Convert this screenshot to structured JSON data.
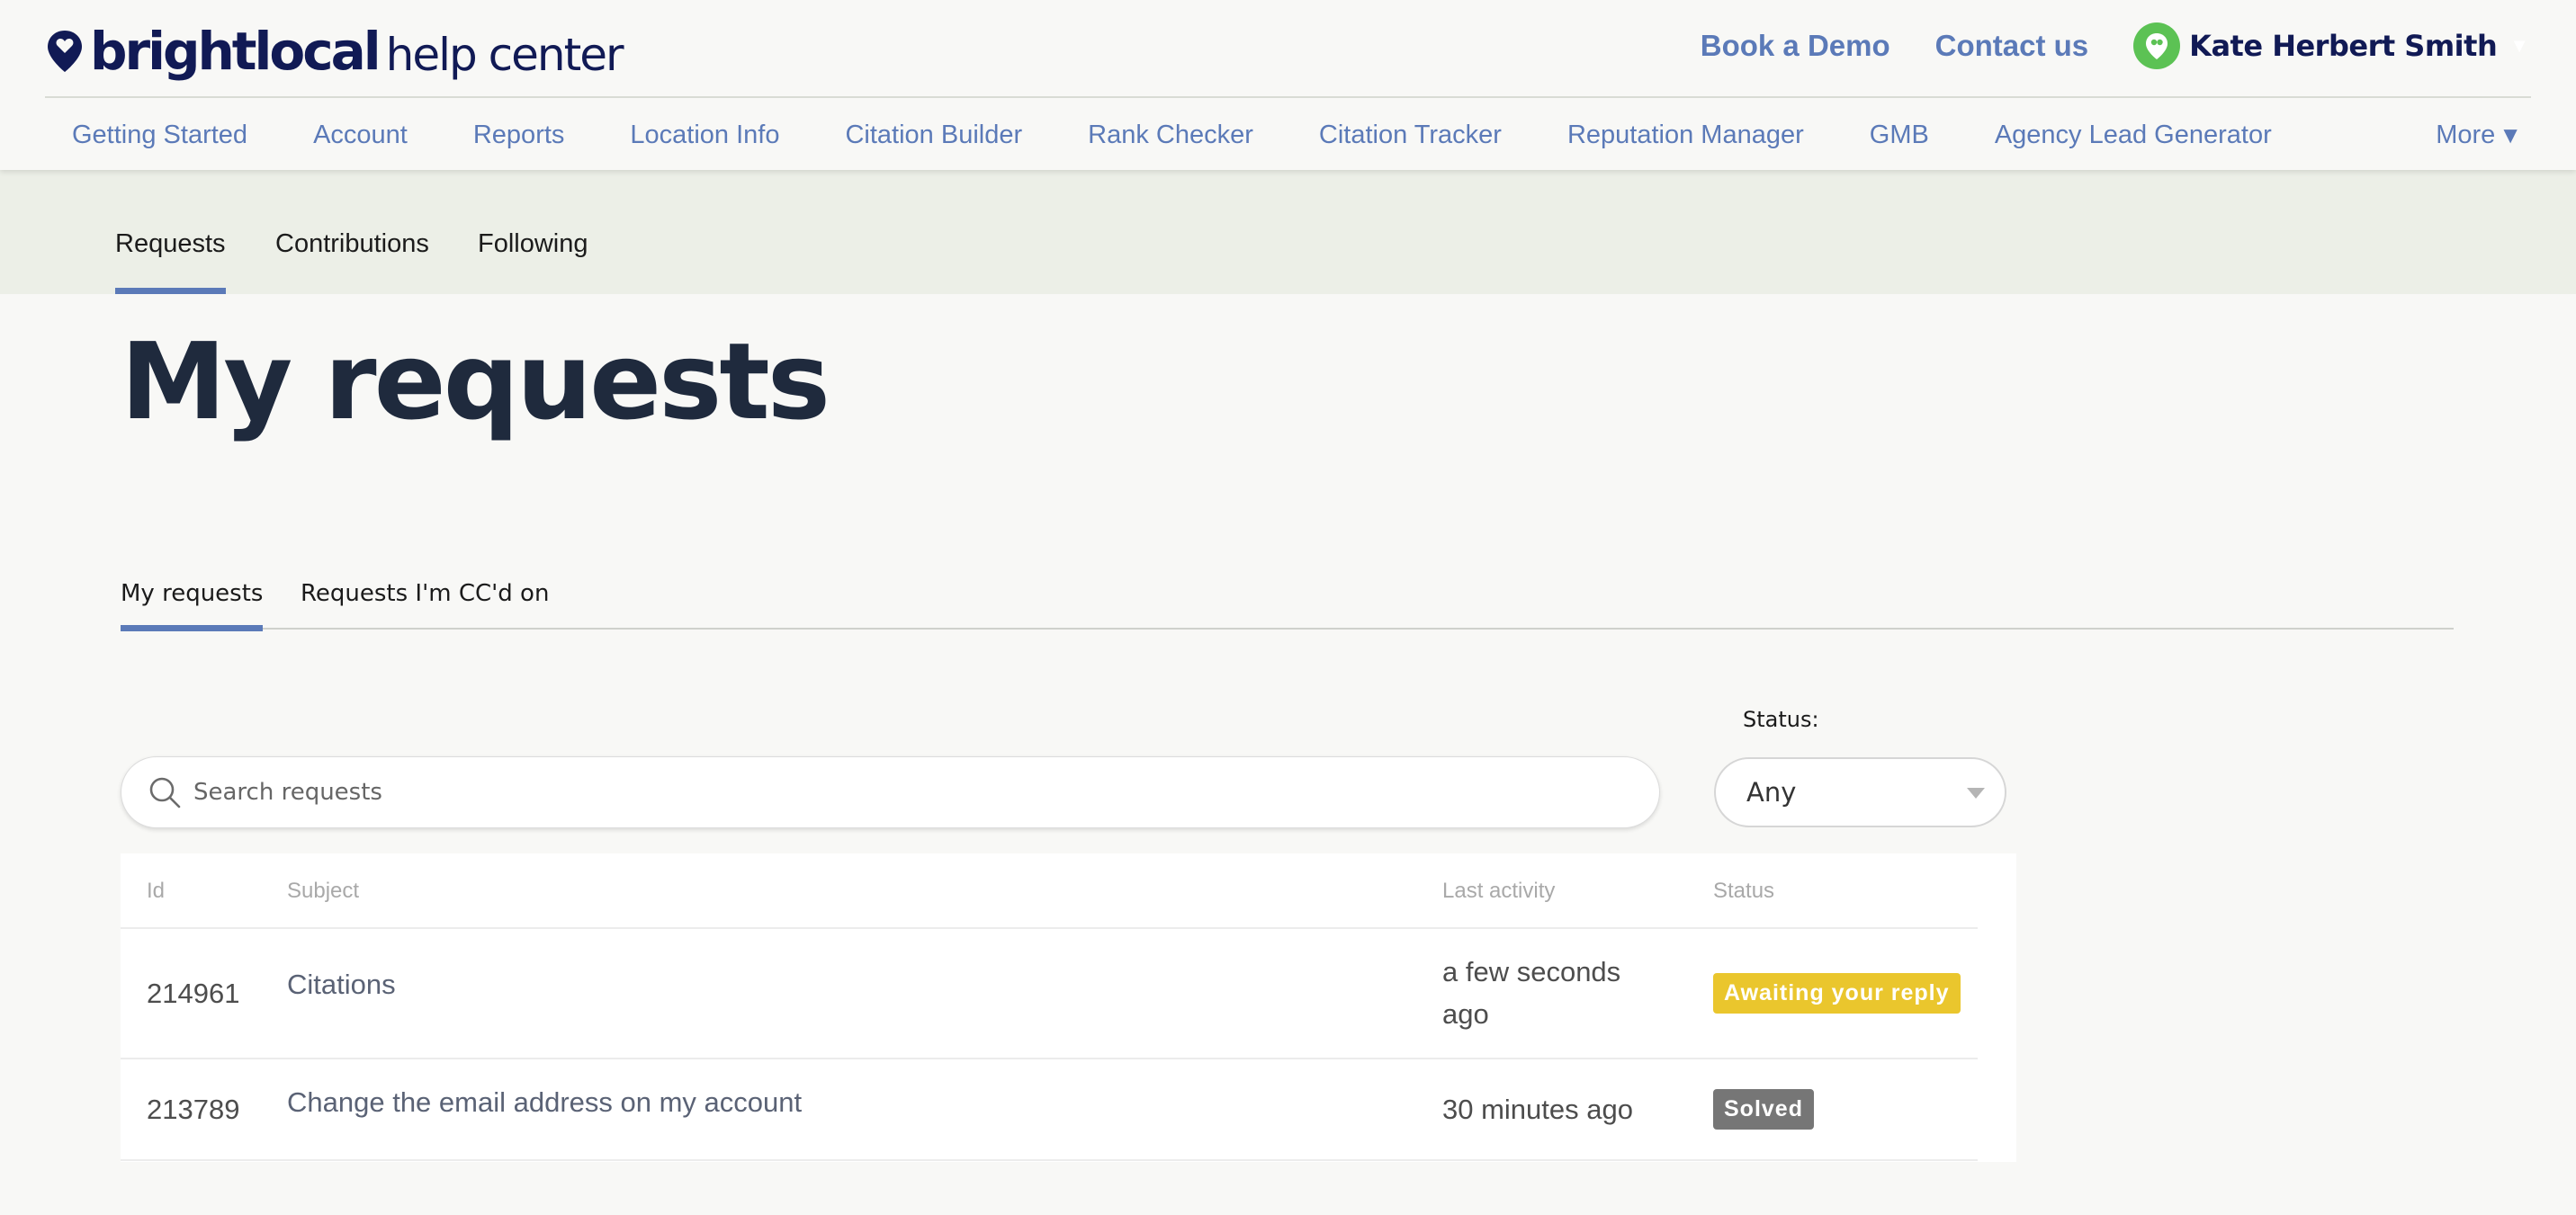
{
  "brand": {
    "logo_primary": "brightlocal",
    "logo_secondary": "help center",
    "color_navy": "#111a55",
    "color_accent": "#5b7ab8",
    "color_green": "#5cc254"
  },
  "header": {
    "book_demo": "Book a Demo",
    "contact": "Contact us",
    "user_name": "Kate Herbert Smith",
    "user_icon": "location-pin-icon"
  },
  "nav": {
    "items": [
      {
        "label": "Getting Started"
      },
      {
        "label": "Account"
      },
      {
        "label": "Reports"
      },
      {
        "label": "Location Info"
      },
      {
        "label": "Citation Builder"
      },
      {
        "label": "Rank Checker"
      },
      {
        "label": "Citation Tracker"
      },
      {
        "label": "Reputation Manager"
      },
      {
        "label": "GMB"
      },
      {
        "label": "Agency Lead Generator"
      }
    ],
    "more_label": "More",
    "more_caret": "▼"
  },
  "subnav": {
    "tabs": [
      {
        "label": "Requests",
        "active": true
      },
      {
        "label": "Contributions",
        "active": false
      },
      {
        "label": "Following",
        "active": false
      }
    ]
  },
  "page": {
    "title": "My requests"
  },
  "request_tabs": [
    {
      "label": "My requests",
      "active": true
    },
    {
      "label": "Requests I'm CC'd on",
      "active": false
    }
  ],
  "filters": {
    "search_placeholder": "Search requests",
    "search_value": "",
    "status_label": "Status:",
    "status_value": "Any"
  },
  "table": {
    "columns": {
      "id": "Id",
      "subject": "Subject",
      "last_activity": "Last activity",
      "status": "Status"
    },
    "rows": [
      {
        "id": "214961",
        "subject": "Citations",
        "last_activity": "a few seconds ago",
        "status": "Awaiting your reply",
        "status_color": "#eac62d"
      },
      {
        "id": "213789",
        "subject": "Change the email address on my account",
        "last_activity": "30 minutes ago",
        "status": "Solved",
        "status_color": "#767676"
      }
    ]
  }
}
